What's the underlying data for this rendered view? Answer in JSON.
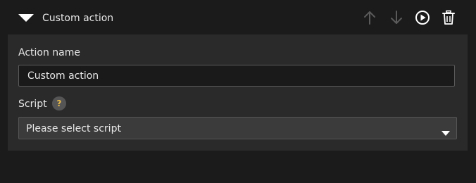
{
  "header": {
    "title": "Custom action",
    "icons": [
      "collapse-triangle-icon",
      "arrow-up-icon",
      "arrow-down-icon",
      "play-circle-icon",
      "trash-icon"
    ]
  },
  "form": {
    "action_name_label": "Action name",
    "action_name_value": "Custom action",
    "script_label": "Script",
    "help_glyph": "?",
    "script_select_value": "Please select script"
  },
  "colors": {
    "background": "#1b1b1b",
    "panel": "#2a2a2a",
    "input_bg": "#1a1a1a",
    "select_bg": "#3b3b3b",
    "help_accent": "#e6b94a",
    "disabled_icon": "#5a5a5a"
  }
}
